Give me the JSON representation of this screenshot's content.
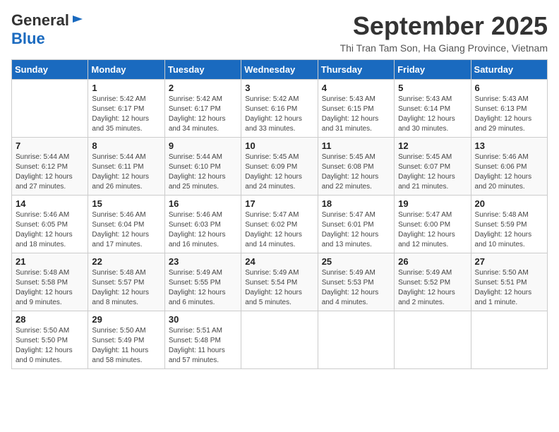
{
  "logo": {
    "line1": "General",
    "line2": "Blue"
  },
  "header": {
    "title": "September 2025",
    "subtitle": "Thi Tran Tam Son, Ha Giang Province, Vietnam"
  },
  "weekdays": [
    "Sunday",
    "Monday",
    "Tuesday",
    "Wednesday",
    "Thursday",
    "Friday",
    "Saturday"
  ],
  "weeks": [
    [
      {
        "day": "",
        "info": ""
      },
      {
        "day": "1",
        "info": "Sunrise: 5:42 AM\nSunset: 6:17 PM\nDaylight: 12 hours\nand 35 minutes."
      },
      {
        "day": "2",
        "info": "Sunrise: 5:42 AM\nSunset: 6:17 PM\nDaylight: 12 hours\nand 34 minutes."
      },
      {
        "day": "3",
        "info": "Sunrise: 5:42 AM\nSunset: 6:16 PM\nDaylight: 12 hours\nand 33 minutes."
      },
      {
        "day": "4",
        "info": "Sunrise: 5:43 AM\nSunset: 6:15 PM\nDaylight: 12 hours\nand 31 minutes."
      },
      {
        "day": "5",
        "info": "Sunrise: 5:43 AM\nSunset: 6:14 PM\nDaylight: 12 hours\nand 30 minutes."
      },
      {
        "day": "6",
        "info": "Sunrise: 5:43 AM\nSunset: 6:13 PM\nDaylight: 12 hours\nand 29 minutes."
      }
    ],
    [
      {
        "day": "7",
        "info": "Sunrise: 5:44 AM\nSunset: 6:12 PM\nDaylight: 12 hours\nand 27 minutes."
      },
      {
        "day": "8",
        "info": "Sunrise: 5:44 AM\nSunset: 6:11 PM\nDaylight: 12 hours\nand 26 minutes."
      },
      {
        "day": "9",
        "info": "Sunrise: 5:44 AM\nSunset: 6:10 PM\nDaylight: 12 hours\nand 25 minutes."
      },
      {
        "day": "10",
        "info": "Sunrise: 5:45 AM\nSunset: 6:09 PM\nDaylight: 12 hours\nand 24 minutes."
      },
      {
        "day": "11",
        "info": "Sunrise: 5:45 AM\nSunset: 6:08 PM\nDaylight: 12 hours\nand 22 minutes."
      },
      {
        "day": "12",
        "info": "Sunrise: 5:45 AM\nSunset: 6:07 PM\nDaylight: 12 hours\nand 21 minutes."
      },
      {
        "day": "13",
        "info": "Sunrise: 5:46 AM\nSunset: 6:06 PM\nDaylight: 12 hours\nand 20 minutes."
      }
    ],
    [
      {
        "day": "14",
        "info": "Sunrise: 5:46 AM\nSunset: 6:05 PM\nDaylight: 12 hours\nand 18 minutes."
      },
      {
        "day": "15",
        "info": "Sunrise: 5:46 AM\nSunset: 6:04 PM\nDaylight: 12 hours\nand 17 minutes."
      },
      {
        "day": "16",
        "info": "Sunrise: 5:46 AM\nSunset: 6:03 PM\nDaylight: 12 hours\nand 16 minutes."
      },
      {
        "day": "17",
        "info": "Sunrise: 5:47 AM\nSunset: 6:02 PM\nDaylight: 12 hours\nand 14 minutes."
      },
      {
        "day": "18",
        "info": "Sunrise: 5:47 AM\nSunset: 6:01 PM\nDaylight: 12 hours\nand 13 minutes."
      },
      {
        "day": "19",
        "info": "Sunrise: 5:47 AM\nSunset: 6:00 PM\nDaylight: 12 hours\nand 12 minutes."
      },
      {
        "day": "20",
        "info": "Sunrise: 5:48 AM\nSunset: 5:59 PM\nDaylight: 12 hours\nand 10 minutes."
      }
    ],
    [
      {
        "day": "21",
        "info": "Sunrise: 5:48 AM\nSunset: 5:58 PM\nDaylight: 12 hours\nand 9 minutes."
      },
      {
        "day": "22",
        "info": "Sunrise: 5:48 AM\nSunset: 5:57 PM\nDaylight: 12 hours\nand 8 minutes."
      },
      {
        "day": "23",
        "info": "Sunrise: 5:49 AM\nSunset: 5:55 PM\nDaylight: 12 hours\nand 6 minutes."
      },
      {
        "day": "24",
        "info": "Sunrise: 5:49 AM\nSunset: 5:54 PM\nDaylight: 12 hours\nand 5 minutes."
      },
      {
        "day": "25",
        "info": "Sunrise: 5:49 AM\nSunset: 5:53 PM\nDaylight: 12 hours\nand 4 minutes."
      },
      {
        "day": "26",
        "info": "Sunrise: 5:49 AM\nSunset: 5:52 PM\nDaylight: 12 hours\nand 2 minutes."
      },
      {
        "day": "27",
        "info": "Sunrise: 5:50 AM\nSunset: 5:51 PM\nDaylight: 12 hours\nand 1 minute."
      }
    ],
    [
      {
        "day": "28",
        "info": "Sunrise: 5:50 AM\nSunset: 5:50 PM\nDaylight: 12 hours\nand 0 minutes."
      },
      {
        "day": "29",
        "info": "Sunrise: 5:50 AM\nSunset: 5:49 PM\nDaylight: 11 hours\nand 58 minutes."
      },
      {
        "day": "30",
        "info": "Sunrise: 5:51 AM\nSunset: 5:48 PM\nDaylight: 11 hours\nand 57 minutes."
      },
      {
        "day": "",
        "info": ""
      },
      {
        "day": "",
        "info": ""
      },
      {
        "day": "",
        "info": ""
      },
      {
        "day": "",
        "info": ""
      }
    ]
  ]
}
